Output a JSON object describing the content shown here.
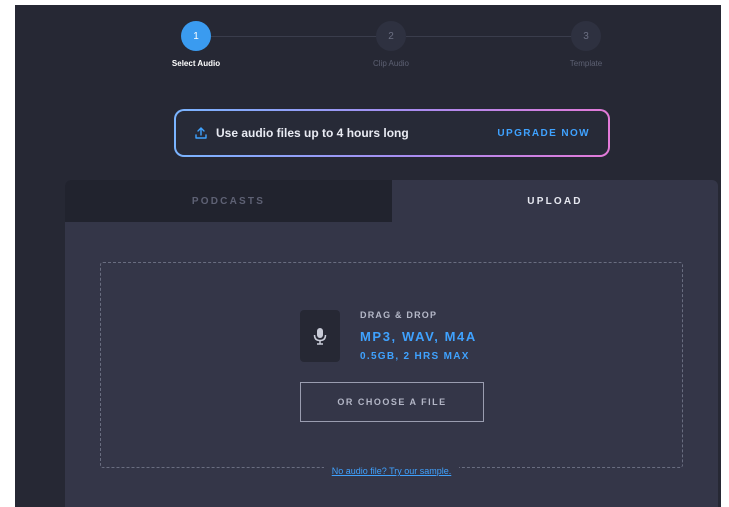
{
  "stepper": {
    "steps": [
      {
        "number": "1",
        "label": "Select Audio"
      },
      {
        "number": "2",
        "label": "Clip Audio"
      },
      {
        "number": "3",
        "label": "Template"
      }
    ],
    "active_step": 1
  },
  "banner": {
    "icon": "upload-icon",
    "text": "Use audio files up to 4 hours long",
    "cta": "UPGRADE NOW"
  },
  "tabs": {
    "items": [
      "PODCASTS",
      "UPLOAD"
    ],
    "active": "UPLOAD"
  },
  "dropzone": {
    "icon": "microphone-icon",
    "label": "DRAG & DROP",
    "formats": "MP3, WAV, M4A",
    "limits": "0.5GB, 2 HRS MAX",
    "choose_button": "OR CHOOSE A FILE",
    "sample_link": "No audio file? Try our sample."
  },
  "colors": {
    "background": "#262834",
    "panel": "#343648",
    "accent": "#3a9bf0",
    "link": "#3fa2ff"
  }
}
